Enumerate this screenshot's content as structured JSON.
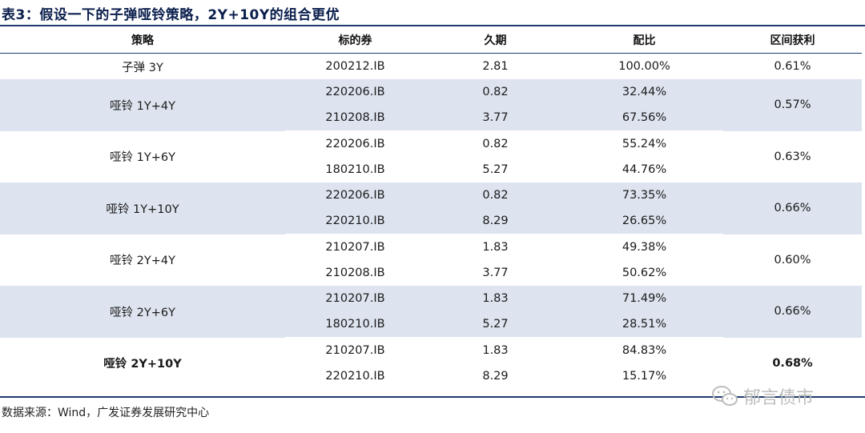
{
  "title": "表3：假设一下的子弹哑铃策略，2Y+10Y的组合更优",
  "table": {
    "headers": [
      "策略",
      "标的券",
      "久期",
      "配比",
      "区间获利"
    ],
    "rows": [
      {
        "strategy": "子弹 3Y",
        "bond": "200212.IB",
        "duration": "2.81",
        "ratio": "100.00%",
        "gain": "0.61%"
      },
      {
        "strategy": "哑铃 1Y+4Y",
        "bond": "220206.IB",
        "duration": "0.82",
        "ratio": "32.44%",
        "gain": "0.57%"
      },
      {
        "strategy": "",
        "bond": "210208.IB",
        "duration": "3.77",
        "ratio": "67.56%",
        "gain": ""
      },
      {
        "strategy": "哑铃 1Y+6Y",
        "bond": "220206.IB",
        "duration": "0.82",
        "ratio": "55.24%",
        "gain": "0.63%"
      },
      {
        "strategy": "",
        "bond": "180210.IB",
        "duration": "5.27",
        "ratio": "44.76%",
        "gain": ""
      },
      {
        "strategy": "哑铃 1Y+10Y",
        "bond": "220206.IB",
        "duration": "0.82",
        "ratio": "73.35%",
        "gain": "0.66%"
      },
      {
        "strategy": "",
        "bond": "220210.IB",
        "duration": "8.29",
        "ratio": "26.65%",
        "gain": ""
      },
      {
        "strategy": "哑铃 2Y+4Y",
        "bond": "210207.IB",
        "duration": "1.83",
        "ratio": "49.38%",
        "gain": "0.60%"
      },
      {
        "strategy": "",
        "bond": "210208.IB",
        "duration": "3.77",
        "ratio": "50.62%",
        "gain": ""
      },
      {
        "strategy": "哑铃 2Y+6Y",
        "bond": "210207.IB",
        "duration": "1.83",
        "ratio": "71.49%",
        "gain": "0.66%"
      },
      {
        "strategy": "",
        "bond": "180210.IB",
        "duration": "5.27",
        "ratio": "28.51%",
        "gain": ""
      },
      {
        "strategy": "哑铃 2Y+10Y",
        "bond": "210207.IB",
        "duration": "1.83",
        "ratio": "84.83%",
        "gain": "0.68%"
      },
      {
        "strategy": "",
        "bond": "220210.IB",
        "duration": "8.29",
        "ratio": "15.17%",
        "gain": ""
      }
    ]
  },
  "source": "数据来源：Wind，广发证券发展研究中心",
  "watermark": {
    "text": "郁言债市",
    "icon": "wechat-icon"
  },
  "colors": {
    "title": "#0b1f4d",
    "rule": "#1f3b6e",
    "shade": "#dde4ef"
  }
}
